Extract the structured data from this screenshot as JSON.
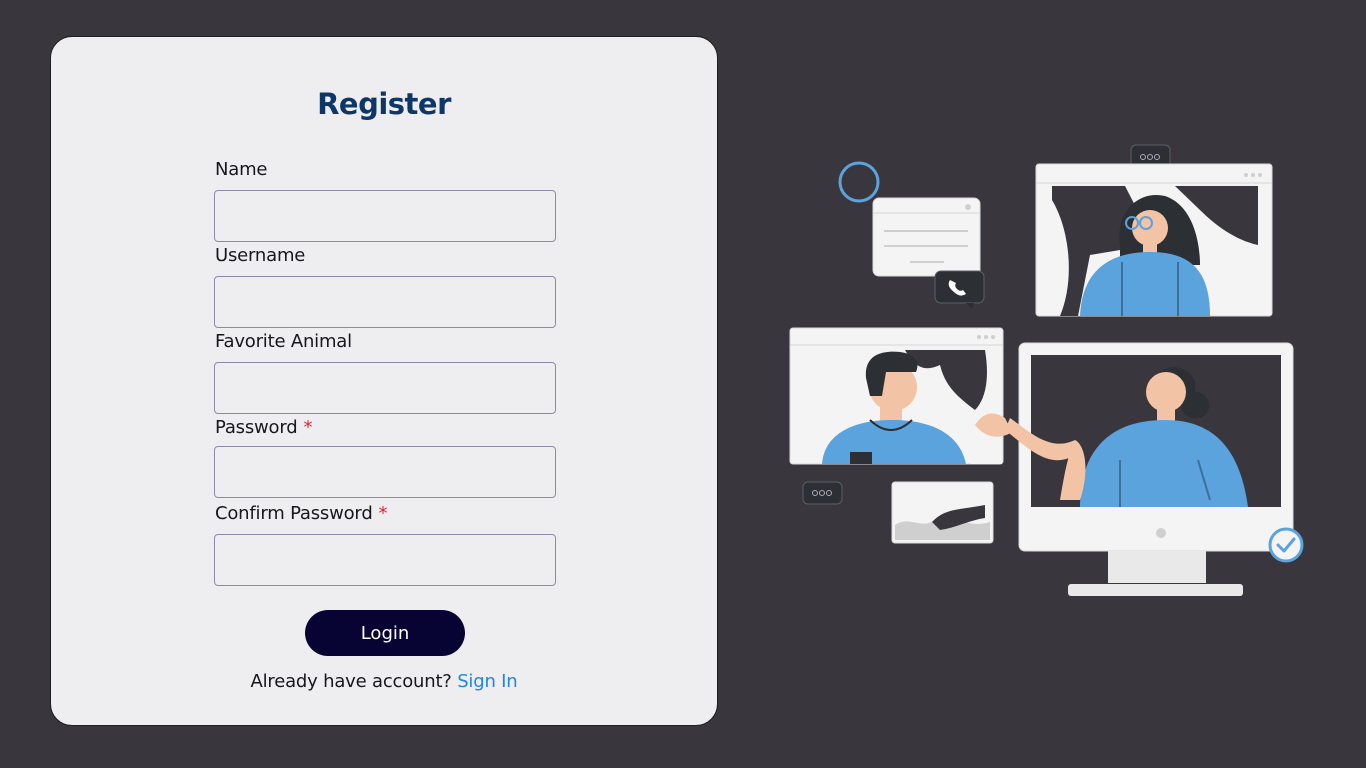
{
  "form": {
    "title": "Register",
    "fields": [
      {
        "label": "Name",
        "required": false,
        "value": ""
      },
      {
        "label": "Username",
        "required": false,
        "value": ""
      },
      {
        "label": "Favorite Animal",
        "required": false,
        "value": ""
      },
      {
        "label": "Password",
        "required": true,
        "value": ""
      },
      {
        "label": "Confirm Password",
        "required": true,
        "value": ""
      }
    ],
    "required_marker": "*",
    "submit_label": "Login",
    "account_prompt": "Already have account?",
    "signin_link": "Sign In"
  },
  "colors": {
    "page_background": "#39363d",
    "card_background": "#eeeef1",
    "title": "#0e3766",
    "button": "#070434",
    "link": "#1f86e0",
    "required": "#e0232e",
    "illustration_accent": "#5ba3dc"
  },
  "illustration": {
    "subject": "video-conference-illustration"
  }
}
